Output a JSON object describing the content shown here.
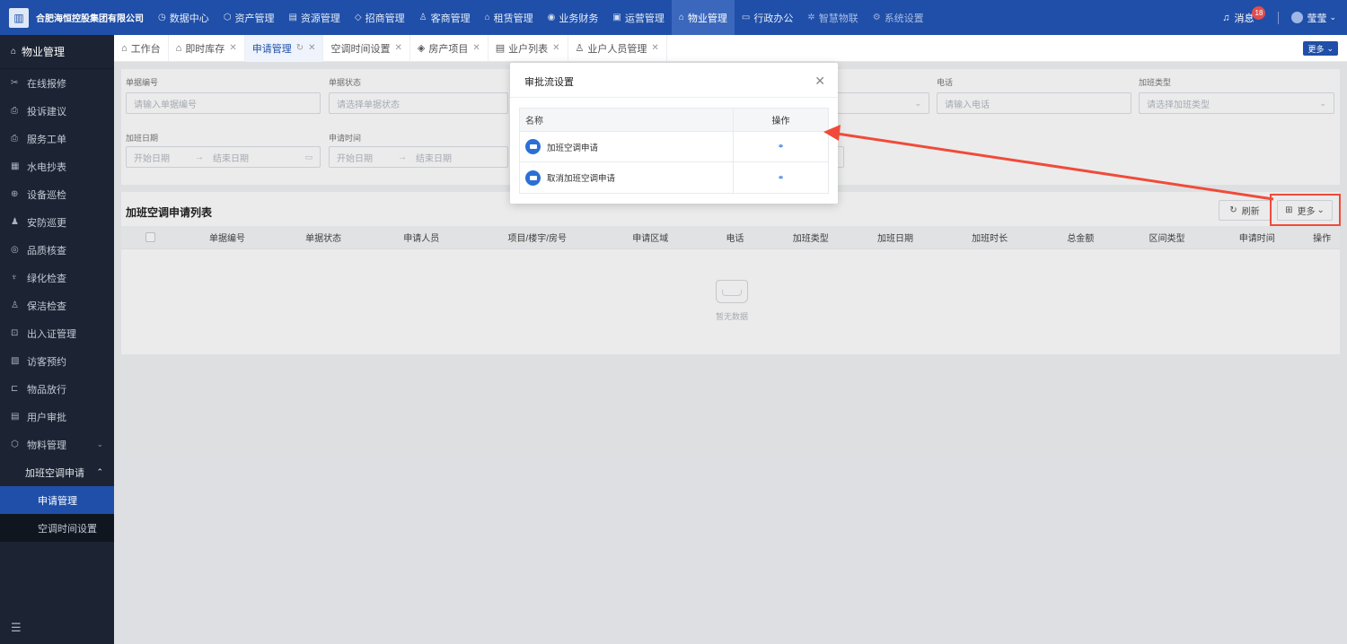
{
  "topbar": {
    "company": "合肥海恒控股集团有限公司",
    "nav": [
      {
        "label": "数据中心",
        "icon": "◷",
        "icon_name": "dashboard-icon"
      },
      {
        "label": "资产管理",
        "icon": "⬡",
        "icon_name": "cube-icon"
      },
      {
        "label": "资源管理",
        "icon": "▤",
        "icon_name": "resource-icon"
      },
      {
        "label": "招商管理",
        "icon": "◇",
        "icon_name": "diamond-icon"
      },
      {
        "label": "客商管理",
        "icon": "♙",
        "icon_name": "people-icon"
      },
      {
        "label": "租赁管理",
        "icon": "⌂",
        "icon_name": "house-icon"
      },
      {
        "label": "业务财务",
        "icon": "◉",
        "icon_name": "coin-icon"
      },
      {
        "label": "运营管理",
        "icon": "▣",
        "icon_name": "operation-icon"
      },
      {
        "label": "物业管理",
        "icon": "⌂",
        "icon_name": "property-icon"
      },
      {
        "label": "行政办公",
        "icon": "▭",
        "icon_name": "monitor-icon"
      },
      {
        "label": "智慧物联",
        "icon": "✲",
        "icon_name": "iot-icon"
      },
      {
        "label": "系统设置",
        "icon": "⚙",
        "icon_name": "settings-icon"
      }
    ],
    "messages_label": "消息",
    "messages_count": "18",
    "user_name": "莹莹"
  },
  "sidebar": {
    "title": "物业管理",
    "items": [
      {
        "label": "在线报修",
        "icon": "✂",
        "icon_name": "repair-icon"
      },
      {
        "label": "投诉建议",
        "icon": "⎙",
        "icon_name": "complaint-icon"
      },
      {
        "label": "服务工单",
        "icon": "⎙",
        "icon_name": "workorder-icon"
      },
      {
        "label": "水电抄表",
        "icon": "▦",
        "icon_name": "meter-icon"
      },
      {
        "label": "设备巡检",
        "icon": "⊕",
        "icon_name": "inspection-icon"
      },
      {
        "label": "安防巡更",
        "icon": "♟",
        "icon_name": "security-icon"
      },
      {
        "label": "品质核查",
        "icon": "◎",
        "icon_name": "quality-icon"
      },
      {
        "label": "绿化检查",
        "icon": "♆",
        "icon_name": "green-icon"
      },
      {
        "label": "保洁检查",
        "icon": "♙",
        "icon_name": "cleaning-icon"
      },
      {
        "label": "出入证管理",
        "icon": "⊡",
        "icon_name": "pass-icon"
      },
      {
        "label": "访客预约",
        "icon": "▧",
        "icon_name": "visitor-icon"
      },
      {
        "label": "物品放行",
        "icon": "⊏",
        "icon_name": "goods-icon"
      },
      {
        "label": "用户审批",
        "icon": "▤",
        "icon_name": "approval-icon"
      },
      {
        "label": "物料管理",
        "icon": "⬡",
        "icon_name": "material-icon"
      }
    ],
    "open_group": "加班空调申请",
    "sub_items": [
      "申请管理",
      "空调时间设置"
    ]
  },
  "tabs": [
    {
      "label": "工作台",
      "icon": "⌂",
      "closable": false
    },
    {
      "label": "即时库存",
      "icon": "⌂",
      "closable": true
    },
    {
      "label": "申请管理",
      "icon": "",
      "closable": true,
      "active": true
    },
    {
      "label": "空调时间设置",
      "icon": "",
      "closable": true
    },
    {
      "label": "房产项目",
      "icon": "◈",
      "closable": true
    },
    {
      "label": "业户列表",
      "icon": "▤",
      "closable": true
    },
    {
      "label": "业户人员管理",
      "icon": "♙",
      "closable": true
    }
  ],
  "tabs_more": "更多",
  "search": {
    "doc_no_label": "单据编号",
    "doc_no_placeholder": "请输入单据编号",
    "status_label": "单据状态",
    "status_placeholder": "请选择单据状态",
    "phone_label": "电话",
    "phone_placeholder": "请输入电话",
    "ot_type_label": "加班类型",
    "ot_type_placeholder": "请选择加班类型",
    "ot_date_label": "加班日期",
    "start_date": "开始日期",
    "end_date": "结束日期",
    "apply_time_label": "申请时间",
    "apply_start": "开始日期",
    "apply_end": "结束日期",
    "range_sep": "→"
  },
  "list": {
    "title": "加班空调申请列表",
    "refresh": "刷新",
    "more": "更多",
    "columns": [
      "单据编号",
      "单据状态",
      "申请人员",
      "项目/楼宇/房号",
      "申请区域",
      "电话",
      "加班类型",
      "加班日期",
      "加班时长",
      "总金额",
      "区间类型",
      "申请时间",
      "操作"
    ],
    "empty_text": "暂无数据"
  },
  "modal": {
    "title": "审批流设置",
    "col_name": "名称",
    "col_op": "操作",
    "rows": [
      {
        "name": "加班空调申请"
      },
      {
        "name": "取消加班空调申请"
      }
    ]
  },
  "colors": {
    "primary": "#1f4fa8",
    "sidebar": "#1c2433",
    "annotation": "#f04b3a"
  }
}
